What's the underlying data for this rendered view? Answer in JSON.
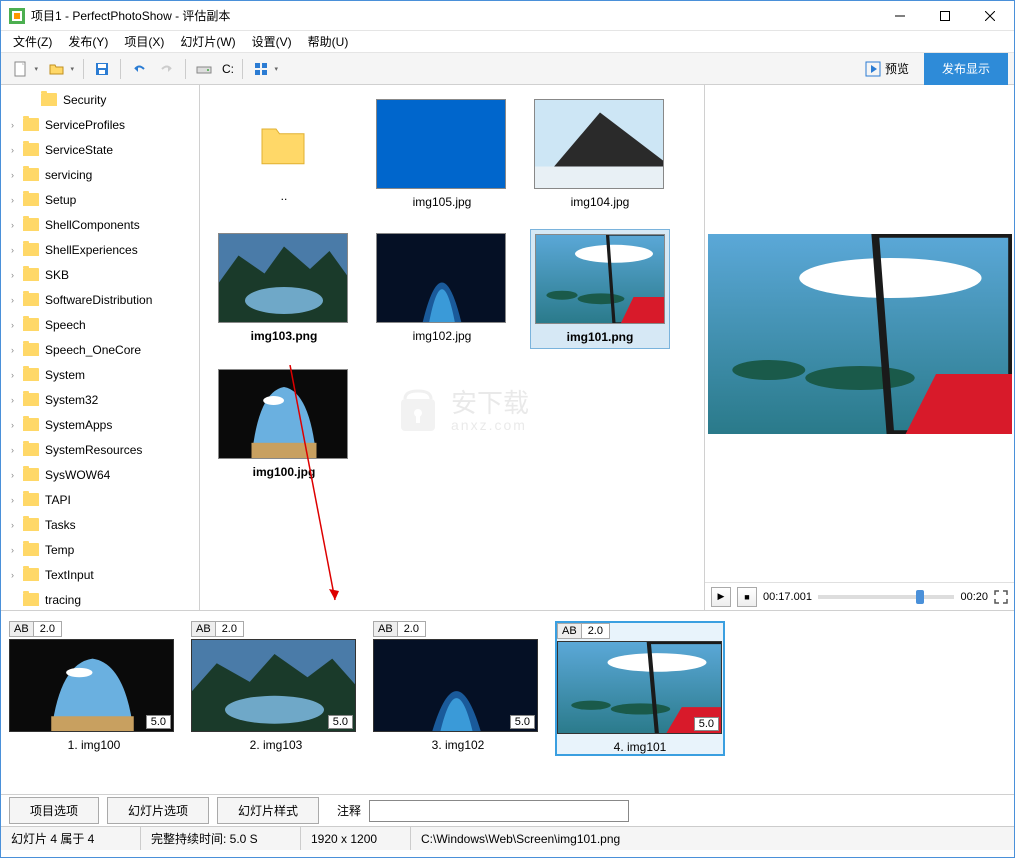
{
  "title": "项目1 - PerfectPhotoShow - 评估副本",
  "menu": [
    "文件(Z)",
    "发布(Y)",
    "项目(X)",
    "幻灯片(W)",
    "设置(V)",
    "帮助(U)"
  ],
  "toolbar": {
    "drive": "C:",
    "preview": "预览",
    "publish": "发布显示"
  },
  "tree": [
    "Security",
    "ServiceProfiles",
    "ServiceState",
    "servicing",
    "Setup",
    "ShellComponents",
    "ShellExperiences",
    "SKB",
    "SoftwareDistribution",
    "Speech",
    "Speech_OneCore",
    "System",
    "System32",
    "SystemApps",
    "SystemResources",
    "SysWOW64",
    "TAPI",
    "Tasks",
    "Temp",
    "TextInput",
    "tracing"
  ],
  "thumbs": [
    {
      "label": "..",
      "type": "folder"
    },
    {
      "label": "img105.jpg",
      "type": "solid"
    },
    {
      "label": "img104.jpg",
      "type": "mountain"
    },
    {
      "label": "img103.png",
      "type": "lake",
      "bold": true
    },
    {
      "label": "img102.jpg",
      "type": "ice"
    },
    {
      "label": "img101.png",
      "type": "plane",
      "selected": true,
      "bold": true
    },
    {
      "label": "img100.jpg",
      "type": "cave",
      "bold": true
    }
  ],
  "watermark": {
    "main": "安下载",
    "sub": "anxz.com"
  },
  "preview": {
    "t1": "00:17.001",
    "t2": "00:20"
  },
  "slides": [
    {
      "ab": "AB",
      "ab_dur": "2.0",
      "dur": "5.0",
      "label": "1. img100",
      "type": "cave"
    },
    {
      "ab": "AB",
      "ab_dur": "2.0",
      "dur": "5.0",
      "label": "2. img103",
      "type": "lake"
    },
    {
      "ab": "AB",
      "ab_dur": "2.0",
      "dur": "5.0",
      "label": "3. img102",
      "type": "ice"
    },
    {
      "ab": "AB",
      "ab_dur": "2.0",
      "dur": "5.0",
      "label": "4. img101",
      "type": "plane",
      "selected": true
    }
  ],
  "buttons": {
    "proj_opts": "项目选项",
    "slide_opts": "幻灯片选项",
    "slide_style": "幻灯片样式",
    "note": "注释"
  },
  "note_value": "",
  "status": {
    "s1": "幻灯片 4 属于 4",
    "s2": "完整持续时间: 5.0 S",
    "s3": "1920 x 1200",
    "s4": "C:\\Windows\\Web\\Screen\\img101.png"
  }
}
